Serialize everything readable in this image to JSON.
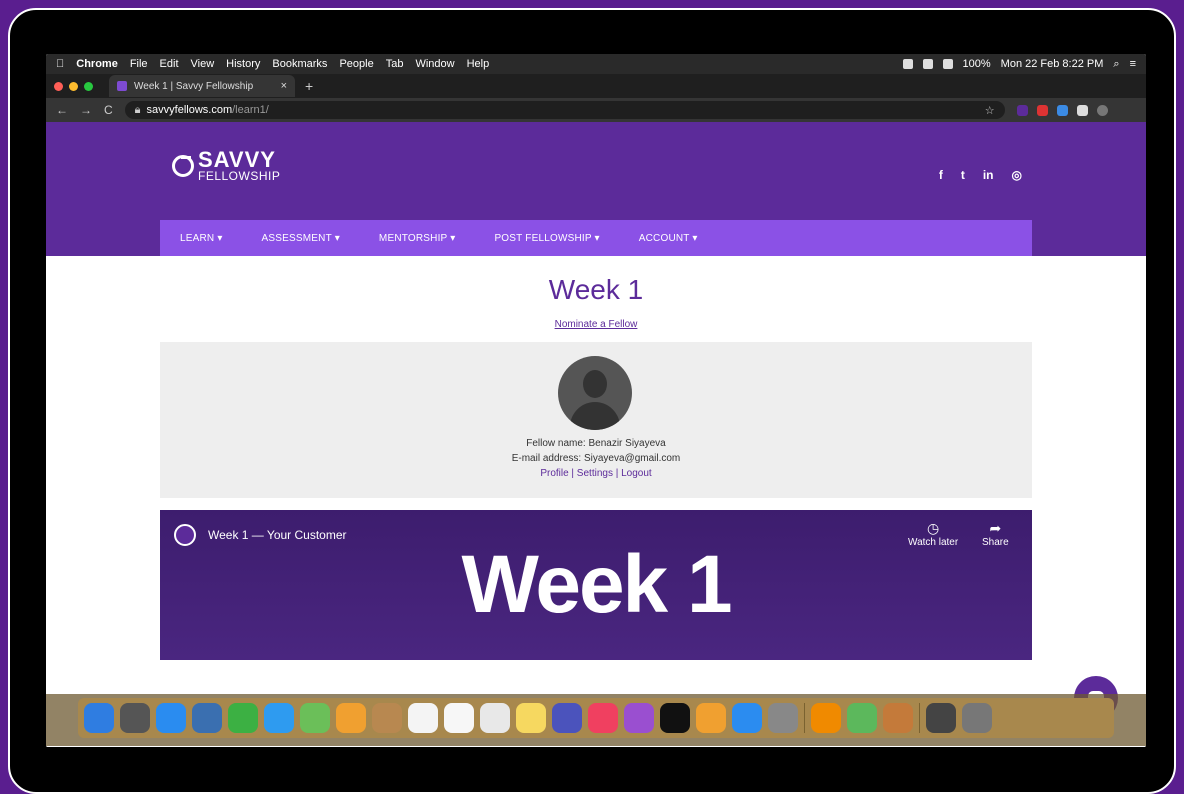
{
  "macmenu": {
    "apple": "",
    "items": [
      "Chrome",
      "File",
      "Edit",
      "View",
      "History",
      "Bookmarks",
      "People",
      "Tab",
      "Window",
      "Help"
    ],
    "battery": "100%",
    "datetime": "Mon 22 Feb  8:22 PM"
  },
  "browser": {
    "tab_title": "Week 1 | Savvy Fellowship",
    "close": "×",
    "new_tab": "+",
    "url_host": "savvyfellows.com",
    "url_path": "/learn1/",
    "back": "←",
    "forward": "→",
    "reload": "C",
    "bookmark_star": "☆"
  },
  "site": {
    "logo_line1": "SAVVY",
    "logo_line2": "FELLOWSHIP",
    "social": [
      "f",
      "t",
      "in",
      "◎"
    ],
    "nav": [
      "LEARN ▾",
      "ASSESSMENT ▾",
      "MENTORSHIP ▾",
      "POST FELLOWSHIP ▾",
      "ACCOUNT ▾"
    ],
    "title": "Week 1",
    "nominate": "Nominate a Fellow",
    "fellow_name": "Fellow name: Benazir Siyayeva",
    "email": "E-mail address: Siyayeva@gmail.com",
    "links": "Profile | Settings | Logout",
    "video_title": "Week 1 — Your Customer",
    "watch_later": "Watch later",
    "share": "Share",
    "video_big": "Week 1"
  },
  "colors": {
    "brand": "#5c2b9a",
    "nav": "#8b51e6"
  },
  "dock_apps": [
    "finder-icon",
    "launchpad-icon",
    "safari-icon",
    "preview-icon",
    "facetime-icon",
    "messages-icon",
    "maps-icon",
    "photos-icon",
    "contacts-icon",
    "calendar-icon",
    "reminders-icon",
    "chrome-icon",
    "notes-icon",
    "teams-icon",
    "music-icon",
    "podcasts-icon",
    "appletv-icon",
    "pages-icon",
    "appstore-icon",
    "settings-icon",
    "vlc-icon",
    "utorrent-icon",
    "books-icon",
    "photo-icon",
    "trash-icon"
  ]
}
